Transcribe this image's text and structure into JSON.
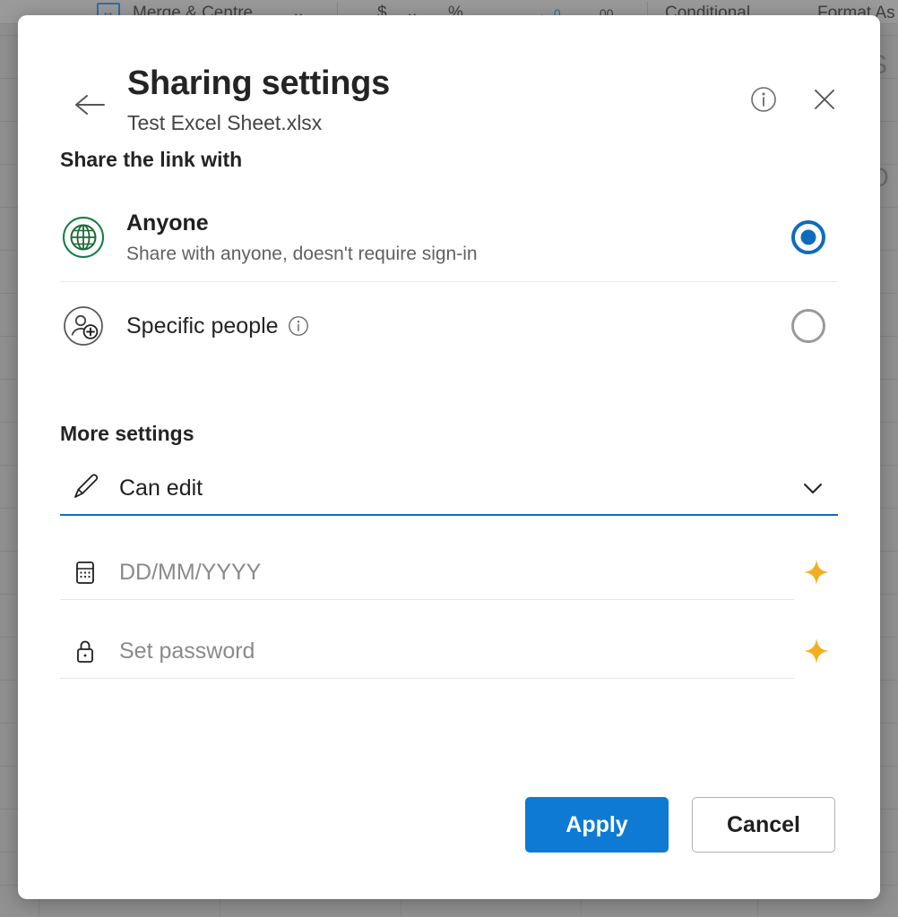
{
  "background": {
    "app": "excel",
    "ribbon_items": [
      {
        "label": "Merge & Centre",
        "icon": "merge-cells-icon",
        "has_chevron": true
      },
      {
        "label": "$",
        "icon": "currency-icon",
        "has_chevron": true
      },
      {
        "label": "%",
        "icon": "percent-icon",
        "has_chevron": false
      },
      {
        "label": ",",
        "icon": "comma-style-icon",
        "has_chevron": false
      },
      {
        "label": "←.0\n.00",
        "icon": "decrease-decimal-icon",
        "has_chevron": false
      },
      {
        "label": ".00\n→.0",
        "icon": "increase-decimal-icon",
        "has_chevron": false
      },
      {
        "label": "Conditional",
        "icon": "conditional-formatting-icon",
        "has_chevron": false
      },
      {
        "label": "Format As",
        "icon": "format-as-table-icon",
        "has_chevron": false
      }
    ],
    "cell_texts": [
      "S",
      "O"
    ]
  },
  "dialog": {
    "title": "Sharing settings",
    "subtitle": "Test Excel Sheet.xlsx",
    "back_label": "Back",
    "info_label": "Info",
    "close_label": "Close",
    "share_section": {
      "heading": "Share the link with",
      "options": [
        {
          "label": "Anyone",
          "description": "Share with anyone, doesn't require sign-in",
          "icon": "globe-icon",
          "icon_color": "#107c41",
          "selected": true,
          "has_info": false
        },
        {
          "label": "Specific people",
          "description": "",
          "icon": "person-add-icon",
          "icon_color": "#424242",
          "selected": false,
          "has_info": true
        }
      ]
    },
    "more_settings": {
      "heading": "More settings",
      "permission_field": {
        "icon": "pencil-icon",
        "value": "Can edit",
        "trailing_icon": "chevron-down-icon",
        "state": "active"
      },
      "expiry_field": {
        "icon": "calendar-icon",
        "placeholder": "DD/MM/YYYY",
        "value": "",
        "trailing_icon": "premium-star-icon",
        "state": "inactive"
      },
      "password_field": {
        "icon": "lock-icon",
        "placeholder": "Set password",
        "value": "",
        "trailing_icon": "premium-star-icon",
        "state": "inactive"
      }
    },
    "footer": {
      "apply_label": "Apply",
      "cancel_label": "Cancel"
    }
  },
  "colors": {
    "accent_blue": "#0f6cbd",
    "primary_button": "#0f7ad4",
    "globe_green": "#107c41",
    "premium_gold": "#f2b01e",
    "backdrop": "#919191"
  }
}
